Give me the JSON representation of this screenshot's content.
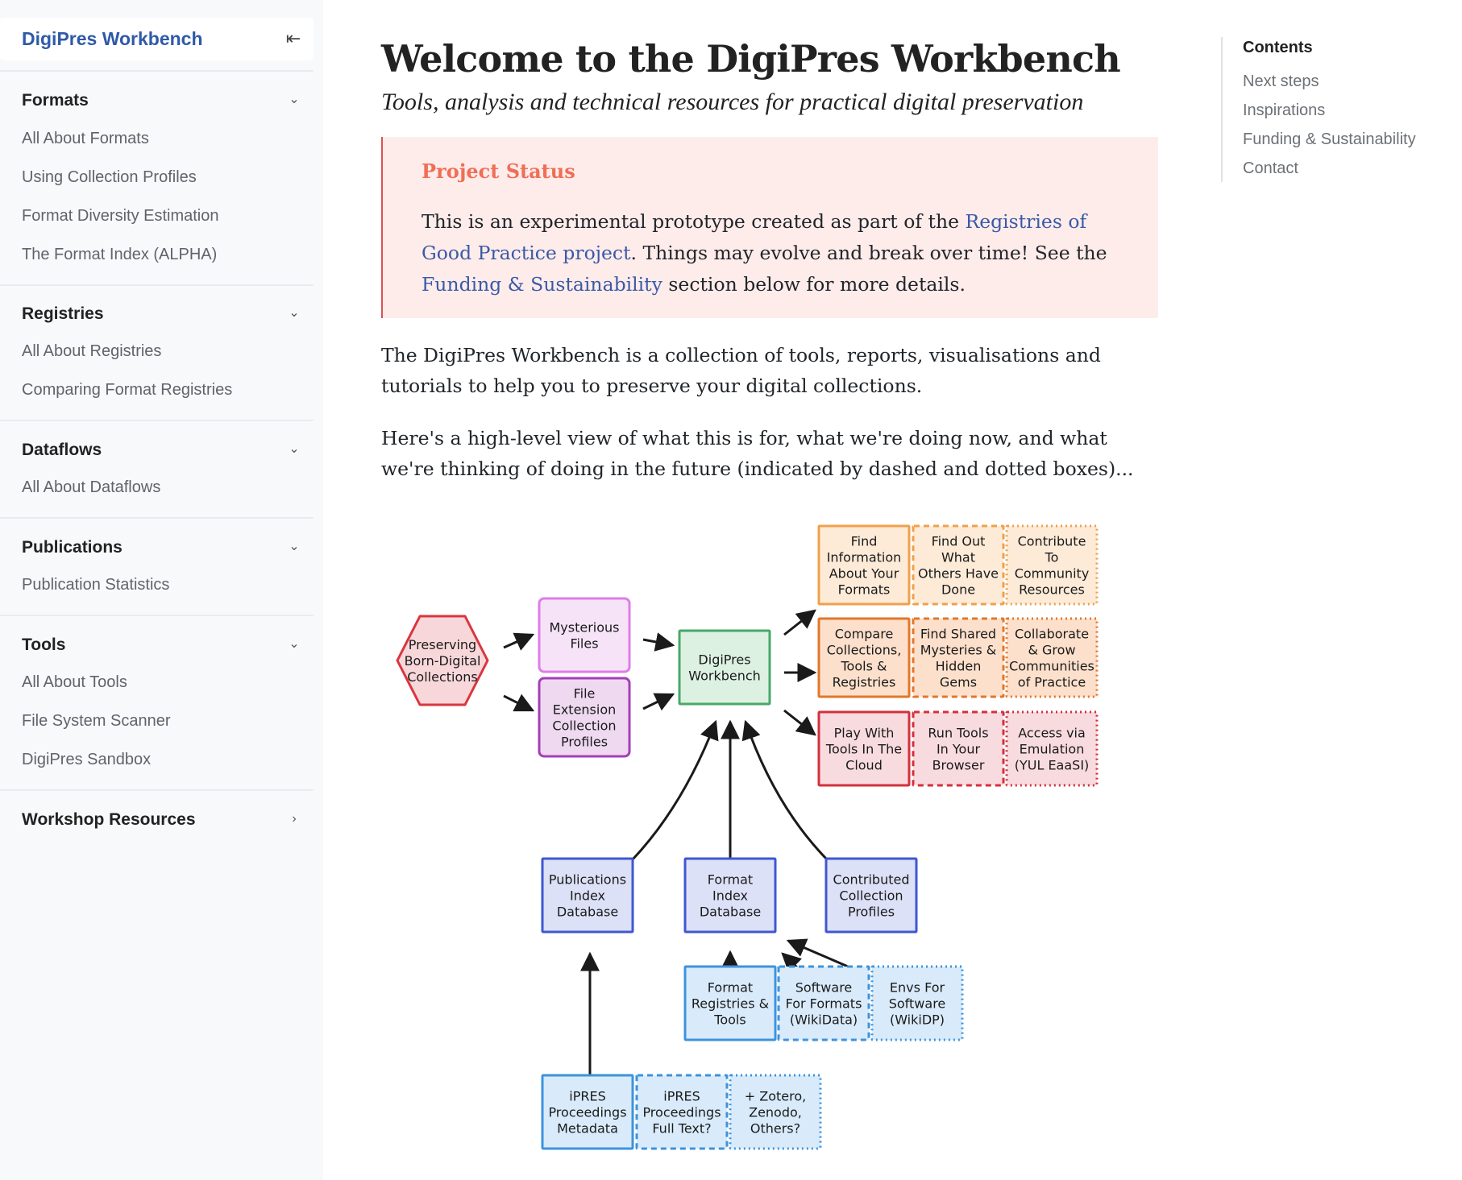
{
  "sidebar": {
    "brand": "DigiPres Workbench",
    "collapse_icon": "collapse-sidebar-icon",
    "sections": [
      {
        "title": "Formats",
        "expanded": true,
        "items": [
          "All About Formats",
          "Using Collection Profiles",
          "Format Diversity Estimation",
          "The Format Index (ALPHA)"
        ]
      },
      {
        "title": "Registries",
        "expanded": true,
        "items": [
          "All About Registries",
          "Comparing Format Registries"
        ]
      },
      {
        "title": "Dataflows",
        "expanded": true,
        "items": [
          "All About Dataflows"
        ]
      },
      {
        "title": "Publications",
        "expanded": true,
        "items": [
          "Publication Statistics"
        ]
      },
      {
        "title": "Tools",
        "expanded": true,
        "items": [
          "All About Tools",
          "File System Scanner",
          "DigiPres Sandbox"
        ]
      },
      {
        "title": "Workshop Resources",
        "expanded": false,
        "items": []
      }
    ]
  },
  "main": {
    "title": "Welcome to the DigiPres Workbench",
    "subtitle": "Tools, analysis and technical resources for practical digital preservation",
    "callout": {
      "title": "Project Status",
      "text_1": "This is an experimental prototype created as part of the ",
      "link_1": "Registries of Good Practice project",
      "text_2": ". Things may evolve and break over time! See the ",
      "link_2": "Funding & Sustainability",
      "text_3": " section below for more details."
    },
    "paragraph_1": "The DigiPres Workbench is a collection of tools, reports, visualisations and tutorials to help you to preserve your digital collections.",
    "paragraph_2": "Here's a high-level view of what this is for, what we're doing now, and what we're thinking of doing in the future (indicated by dashed and dotted boxes)..."
  },
  "toc": {
    "heading": "Contents",
    "links": [
      "Next steps",
      "Inspirations",
      "Funding & Sustainability",
      "Contact"
    ]
  },
  "diagram": {
    "nodes": [
      {
        "id": "preserving",
        "lines": [
          "Preserving",
          "Born-Digital",
          "Collections"
        ]
      },
      {
        "id": "mysterious",
        "lines": [
          "Mysterious",
          "Files"
        ]
      },
      {
        "id": "fileext",
        "lines": [
          "File",
          "Extension",
          "Collection",
          "Profiles"
        ]
      },
      {
        "id": "workbench",
        "lines": [
          "DigiPres",
          "Workbench"
        ]
      },
      {
        "id": "findinfo",
        "lines": [
          "Find",
          "Information",
          "About Your",
          "Formats"
        ]
      },
      {
        "id": "findout",
        "lines": [
          "Find Out",
          "What",
          "Others Have",
          "Done"
        ]
      },
      {
        "id": "contribute",
        "lines": [
          "Contribute",
          "To",
          "Community",
          "Resources"
        ]
      },
      {
        "id": "compare",
        "lines": [
          "Compare",
          "Collections,",
          "Tools &",
          "Registries"
        ]
      },
      {
        "id": "findshared",
        "lines": [
          "Find Shared",
          "Mysteries &",
          "Hidden",
          "Gems"
        ]
      },
      {
        "id": "collaborate",
        "lines": [
          "Collaborate",
          "& Grow",
          "Communities",
          "of Practice"
        ]
      },
      {
        "id": "play",
        "lines": [
          "Play With",
          "Tools In The",
          "Cloud"
        ]
      },
      {
        "id": "runtools",
        "lines": [
          "Run Tools",
          "In Your",
          "Browser"
        ]
      },
      {
        "id": "access",
        "lines": [
          "Access via",
          "Emulation",
          "(YUL EaaSI)"
        ]
      },
      {
        "id": "pubindex",
        "lines": [
          "Publications",
          "Index",
          "Database"
        ]
      },
      {
        "id": "fmtindex",
        "lines": [
          "Format",
          "Index",
          "Database"
        ]
      },
      {
        "id": "contributed",
        "lines": [
          "Contributed",
          "Collection",
          "Profiles"
        ]
      },
      {
        "id": "fmtreg",
        "lines": [
          "Format",
          "Registries &",
          "Tools"
        ]
      },
      {
        "id": "software",
        "lines": [
          "Software",
          "For Formats",
          "(WikiData)"
        ]
      },
      {
        "id": "envs",
        "lines": [
          "Envs For",
          "Software",
          "(WikiDP)"
        ]
      },
      {
        "id": "ipresmeta",
        "lines": [
          "iPRES",
          "Proceedings",
          "Metadata"
        ]
      },
      {
        "id": "ipresfull",
        "lines": [
          "iPRES",
          "Proceedings",
          "Full Text?"
        ]
      },
      {
        "id": "zotero",
        "lines": [
          "+ Zotero,",
          "Zenodo,",
          "Others?"
        ]
      }
    ]
  },
  "colors": {
    "accent": "#2f59a8",
    "link": "#3a5aa6",
    "callout_bg": "#feeceb",
    "callout_title": "#ee6f55"
  }
}
